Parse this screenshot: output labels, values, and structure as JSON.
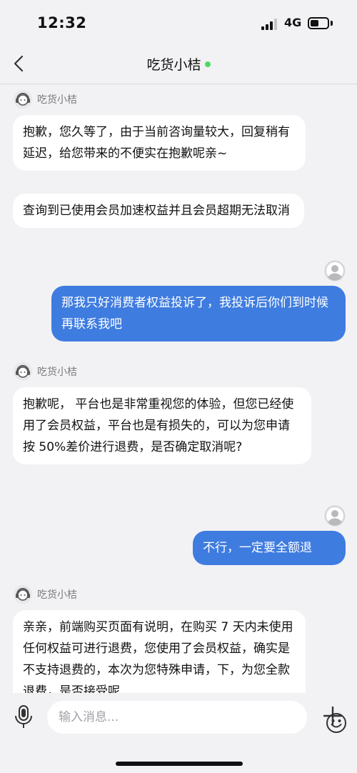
{
  "status_bar": {
    "time": "12:32",
    "network": "4G"
  },
  "header": {
    "title": "吃货小桔"
  },
  "messages": [
    {
      "sender": "agent",
      "name": "吃货小桔",
      "bubbles": [
        "抱歉，您久等了，由于当前咨询量较大，回复稍有延迟，给您带来的不便实在抱歉呢亲~",
        "查询到已使用会员加速权益并且会员超期无法取消"
      ]
    },
    {
      "sender": "user",
      "text": "那我只好消费者权益投诉了，我投诉后你们到时候再联系我吧"
    },
    {
      "sender": "agent",
      "name": "吃货小桔",
      "bubbles": [
        "抱歉呢， 平台也是非常重视您的体验，但您已经使用了会员权益，平台也是有损失的，可以为您申请按 50%差价进行退费，是否确定取消呢?"
      ]
    },
    {
      "sender": "user",
      "text": "不行，一定要全额退"
    },
    {
      "sender": "agent",
      "name": "吃货小桔",
      "bubbles": [
        "亲亲，前端购买页面有说明，在购买 7 天内未使用任何权益可进行退费，您使用了会员权益，确实是不支持退费的，本次为您特殊申请，下，为您全款退费，是否接受呢"
      ]
    }
  ],
  "input": {
    "placeholder": "输入消息..."
  },
  "icons": {
    "back": "chevron-left-icon",
    "agent_avatar": "agent-headset-avatar-icon",
    "user_avatar": "user-avatar-icon",
    "mic": "microphone-icon",
    "emoji": "smiley-icon",
    "plus": "plus-icon"
  },
  "colors": {
    "user_bubble": "#3f7ce0",
    "online": "#4cd964",
    "background": "#f2f2f4"
  }
}
